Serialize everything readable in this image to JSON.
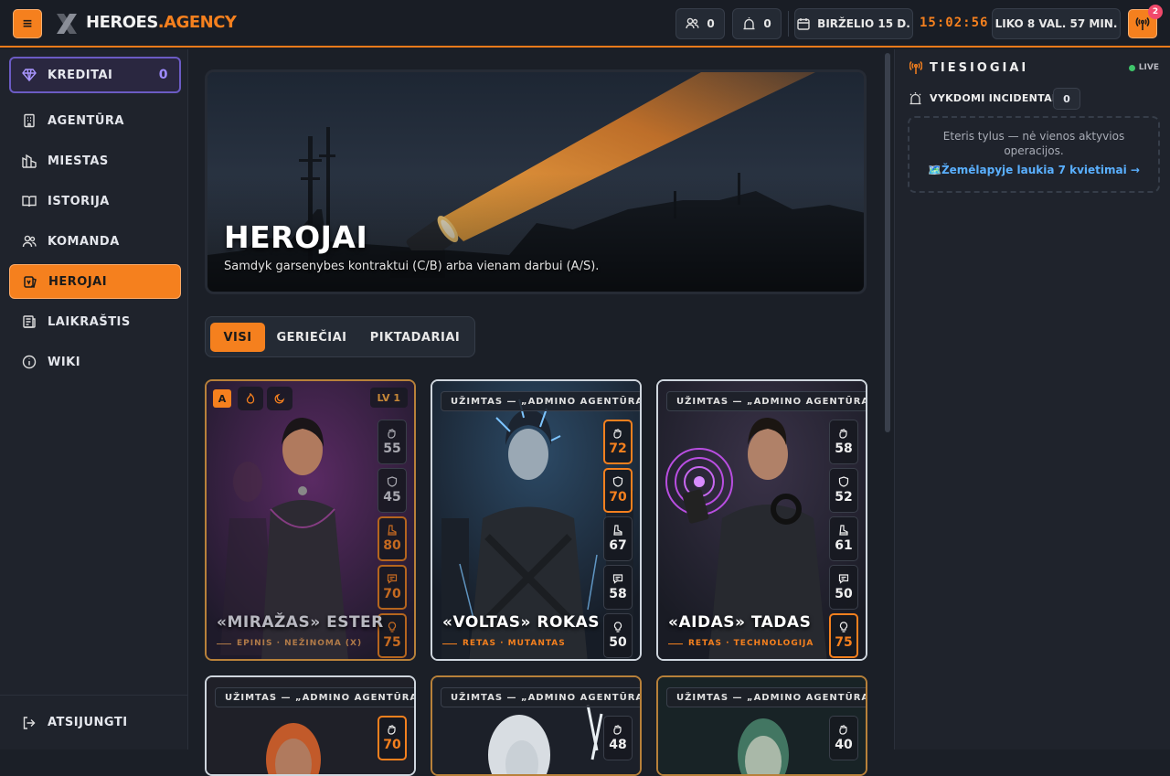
{
  "topbar": {
    "logo_main": "HEROES",
    "logo_accent": ".AGENCY",
    "users_count": "0",
    "alerts_count": "0",
    "date": "BIRŽELIO 15 D.",
    "clock": "15:02:56",
    "remaining": "LIKO 8 VAL. 57 MIN.",
    "notif_count": "2",
    "accent": "#f5801e"
  },
  "sidebar": {
    "credits_label": "KREDITAI",
    "credits_value": "0",
    "items": [
      {
        "label": "AGENTŪRA",
        "icon": "building-icon"
      },
      {
        "label": "MIESTAS",
        "icon": "city-icon"
      },
      {
        "label": "ISTORIJA",
        "icon": "book-icon"
      },
      {
        "label": "KOMANDA",
        "icon": "team-icon"
      },
      {
        "label": "HEROJAI",
        "icon": "heroes-icon",
        "active": true
      },
      {
        "label": "LAIKRAŠTIS",
        "icon": "newspaper-icon"
      },
      {
        "label": "WIKI",
        "icon": "info-icon"
      }
    ],
    "logout_label": "ATSIJUNGTI"
  },
  "banner": {
    "title": "HEROJAI",
    "subtitle": "Samdyk garsenybes kontraktui (C/B) arba vienam darbui (A/S)."
  },
  "tabs": [
    "VISI",
    "GERIEČIAI",
    "PIKTADARIAI"
  ],
  "cards": [
    {
      "name": "«MIRAŽAS» ESTER",
      "tags": "EPINIS · NEŽINOMA (X)",
      "busy": "",
      "grade": "A",
      "level": "LV 1",
      "stats": [
        "55",
        "45",
        "80",
        "70",
        "75"
      ],
      "highlight": [
        false,
        false,
        true,
        true,
        true
      ]
    },
    {
      "name": "«VOLTAS» ROKAS",
      "tags": "RETAS · MUTANTAS",
      "busy": "UŽIMTAS — „ADMINO AGENTŪRA\"",
      "stats": [
        "72",
        "70",
        "67",
        "58",
        "50"
      ],
      "highlight": [
        true,
        true,
        false,
        false,
        false
      ]
    },
    {
      "name": "«AIDAS» TADAS",
      "tags": "RETAS · TECHNOLOGIJA",
      "busy": "UŽIMTAS — „ADMINO AGENTŪRA\"",
      "stats": [
        "58",
        "52",
        "61",
        "50",
        "75"
      ],
      "highlight": [
        false,
        false,
        false,
        false,
        true
      ]
    },
    {
      "busy": "UŽIMTAS — „ADMINO AGENTŪRA\"",
      "stats": [
        "70"
      ],
      "highlight": [
        true
      ]
    },
    {
      "busy": "UŽIMTAS — „ADMINO AGENTŪRA\"",
      "stats": [
        "48"
      ],
      "highlight": [
        false
      ]
    },
    {
      "busy": "UŽIMTAS — „ADMINO AGENTŪRA\"",
      "stats": [
        "40"
      ],
      "highlight": [
        false
      ]
    }
  ],
  "right_panel": {
    "title": "TIESIOGIAI",
    "live": "LIVE",
    "incidents_label": "VYKDOMI INCIDENTAI",
    "incidents_count": "0",
    "empty_text": "Eteris tylus — nė vienos aktyvios operacijos.",
    "map_link": "🗺️Žemėlapyje laukia 7 kvietimai →"
  }
}
